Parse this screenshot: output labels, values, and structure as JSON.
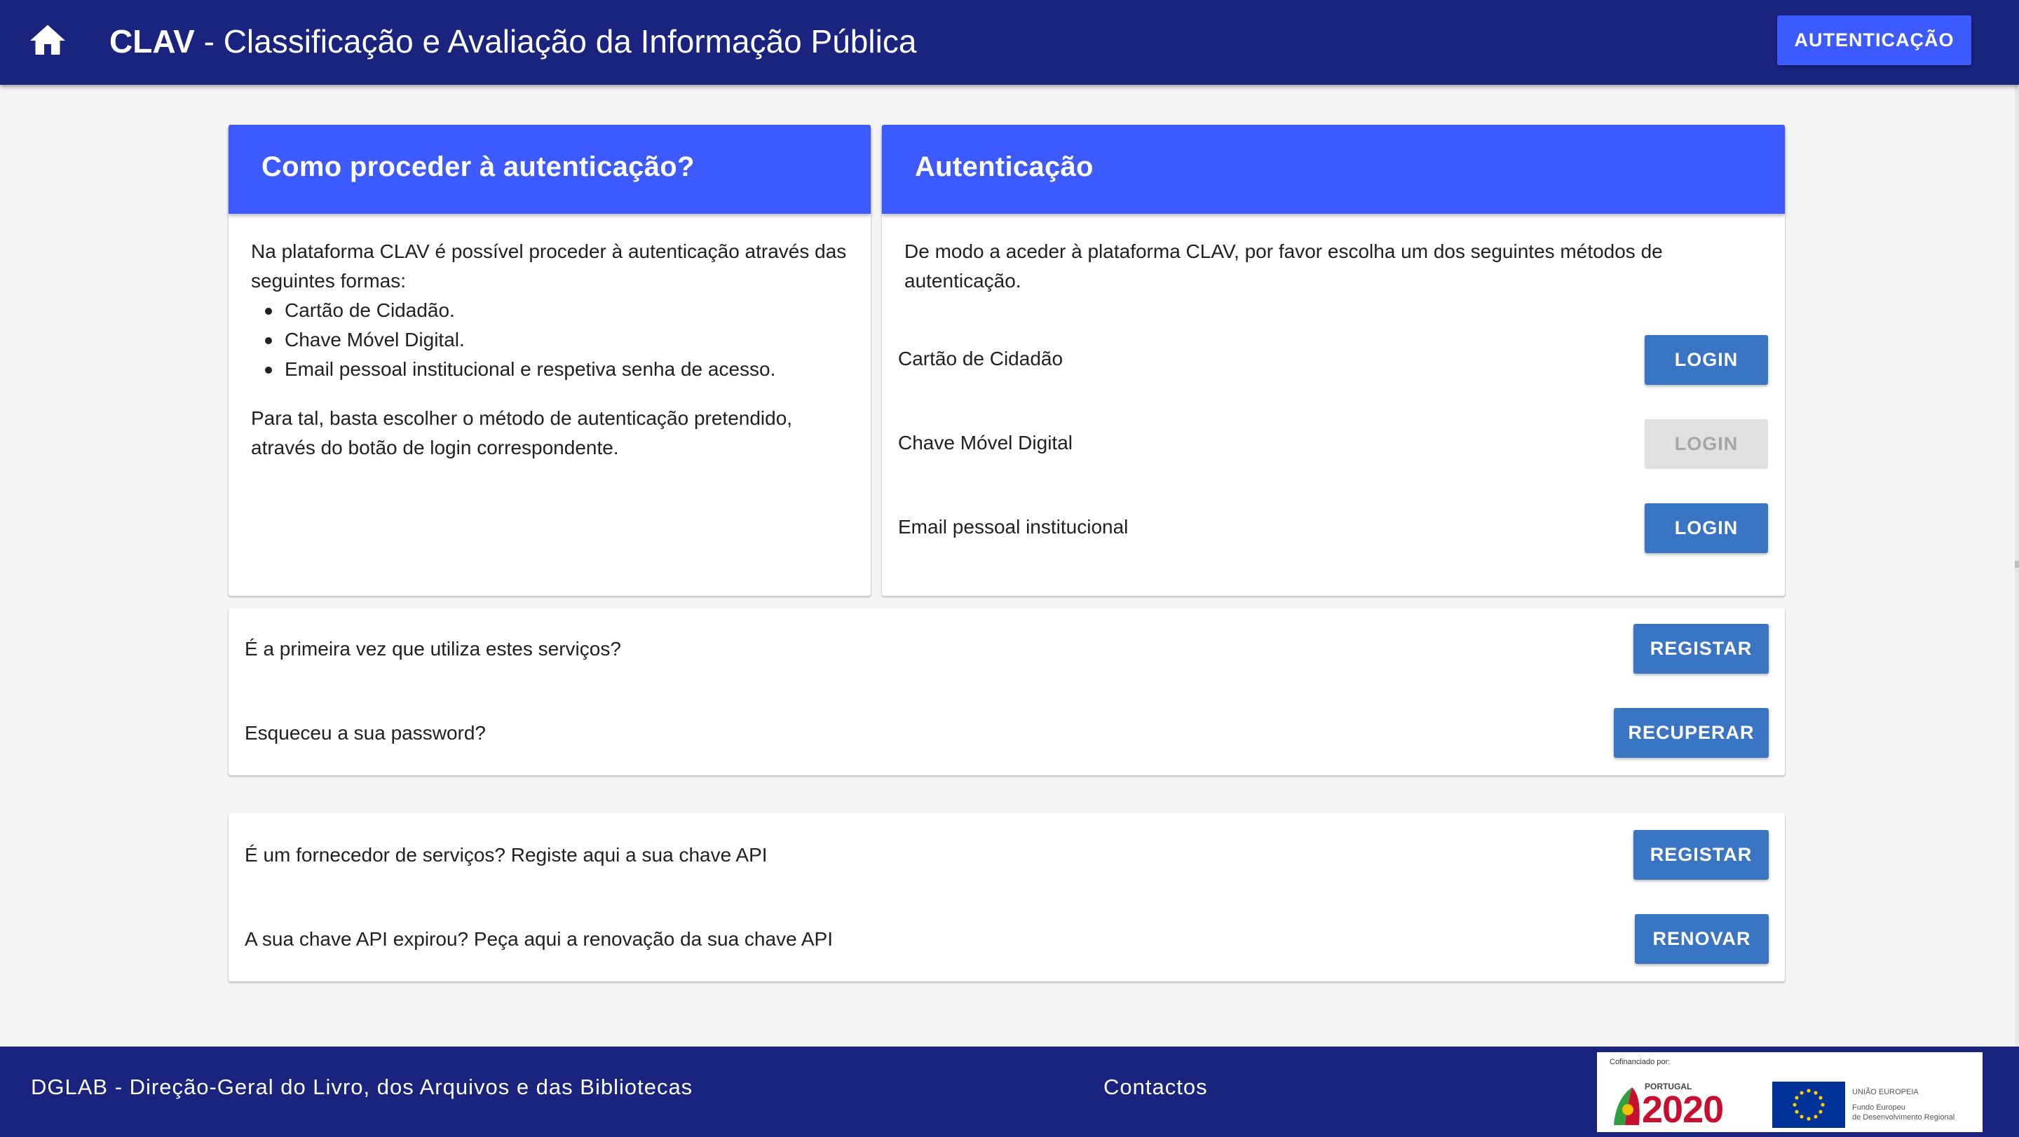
{
  "header": {
    "brand": "CLAV",
    "subtitle": " - Classificação e Avaliação da Informação Pública",
    "auth_button": "AUTENTICAÇÃO",
    "home_icon": "home-icon"
  },
  "info_card": {
    "title": "Como proceder à autenticação?",
    "intro": "Na plataforma CLAV é possível proceder à autenticação através das seguintes formas:",
    "methods": [
      "Cartão de Cidadão.",
      "Chave Móvel Digital.",
      "Email pessoal institucional e respetiva senha de acesso."
    ],
    "outro": "Para tal, basta escolher o método de autenticação pretendido, através do botão de login correspondente."
  },
  "auth_card": {
    "title": "Autenticação",
    "intro": "De modo a aceder à plataforma CLAV, por favor escolha um dos seguintes métodos de autenticação.",
    "rows": [
      {
        "label": "Cartão de Cidadão",
        "button": "LOGIN",
        "enabled": true
      },
      {
        "label": "Chave Móvel Digital",
        "button": "LOGIN",
        "enabled": false
      },
      {
        "label": "Email pessoal institucional",
        "button": "LOGIN",
        "enabled": true
      }
    ]
  },
  "account_card": {
    "rows": [
      {
        "label": "É a primeira vez que utiliza estes serviços?",
        "button": "REGISTAR"
      },
      {
        "label": "Esqueceu a sua password?",
        "button": "RECUPERAR"
      }
    ]
  },
  "api_card": {
    "rows": [
      {
        "label": "É um fornecedor de serviços? Registe aqui a sua chave API",
        "button": "REGISTAR"
      },
      {
        "label": "A sua chave API expirou? Peça aqui a renovação da sua chave API",
        "button": "RENOVAR"
      }
    ]
  },
  "footer": {
    "org": "DGLAB - Direção-Geral do Livro, dos Arquivos e das Bibliotecas",
    "contacts": "Contactos",
    "logo": {
      "cofinanced": "Cofinanciado por:",
      "portugal": "PORTUGAL",
      "year": "2020",
      "eu_line1": "UNIÃO EUROPEIA",
      "eu_line2": "Fundo Europeu",
      "eu_line3": "de Desenvolvimento Regional"
    }
  },
  "colors": {
    "topbar": "#1a237e",
    "card_header": "#3d5afe",
    "button": "#3a75c4",
    "button_disabled": "#e0e0e0"
  }
}
